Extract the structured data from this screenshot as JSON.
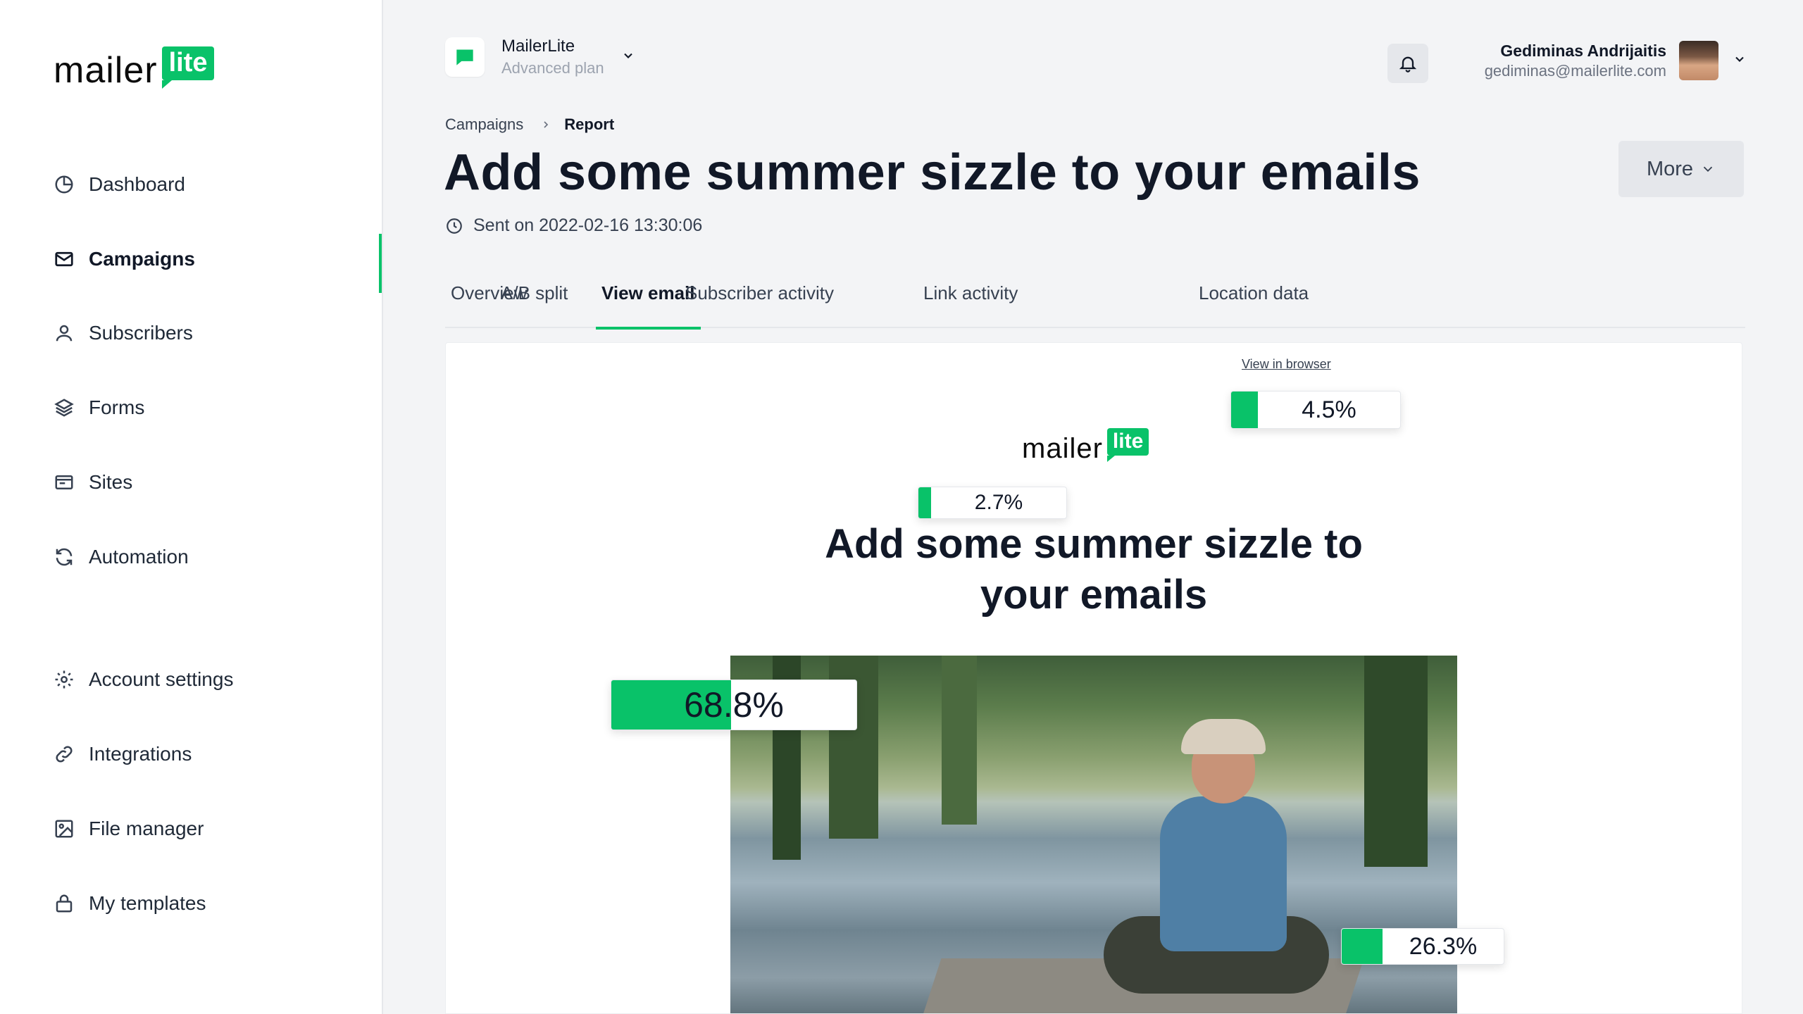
{
  "sidebar": {
    "logo": {
      "mailer": "mailer",
      "lite": "lite"
    },
    "items": [
      {
        "label": "Dashboard",
        "icon": "dashboard-icon"
      },
      {
        "label": "Campaigns",
        "icon": "envelope-icon",
        "active": true
      },
      {
        "label": "Subscribers",
        "icon": "user-icon"
      },
      {
        "label": "Forms",
        "icon": "layers-icon"
      },
      {
        "label": "Sites",
        "icon": "browser-icon"
      },
      {
        "label": "Automation",
        "icon": "refresh-icon"
      },
      {
        "label": "Account settings",
        "icon": "gear-icon"
      },
      {
        "label": "Integrations",
        "icon": "link-icon"
      },
      {
        "label": "File manager",
        "icon": "image-icon"
      },
      {
        "label": "My templates",
        "icon": "lock-icon"
      }
    ]
  },
  "header": {
    "account_name": "MailerLite",
    "account_plan": "Advanced plan",
    "user_name": "Gediminas Andrijaitis",
    "user_email": "gediminas@mailerlite.com"
  },
  "breadcrumb": {
    "parent": "Campaigns",
    "current": "Report"
  },
  "page": {
    "title": "Add some summer sizzle to your emails",
    "sent": "Sent on 2022-02-16 13:30:06",
    "more_label": "More"
  },
  "tabs": [
    {
      "label": "Overview"
    },
    {
      "label": "A/B split"
    },
    {
      "label": "View email",
      "active": true
    },
    {
      "label": "Subscriber activity"
    },
    {
      "label": "Link activity"
    },
    {
      "label": "Location data"
    }
  ],
  "email": {
    "view_in_browser": "View in browser",
    "logo_mailer": "mailer",
    "logo_lite": "lite",
    "heading": "Add some summer sizzle to your emails"
  },
  "click_rates": [
    {
      "label": "4.5%",
      "fill_pct": 4.5
    },
    {
      "label": "2.7%",
      "fill_pct": 2.7
    },
    {
      "label": "68.8%",
      "fill_pct": 68.8
    },
    {
      "label": "26.3%",
      "fill_pct": 26.3
    }
  ],
  "colors": {
    "brand": "#09c269",
    "background": "#f3f4f6"
  }
}
